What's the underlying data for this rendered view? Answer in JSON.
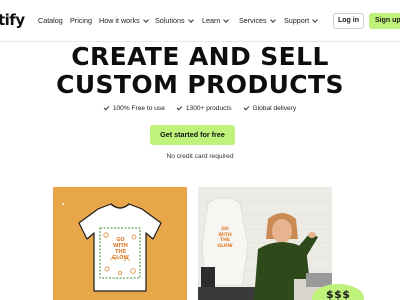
{
  "brand": {
    "logo_text": "tify"
  },
  "nav": {
    "items": [
      {
        "label": "Catalog",
        "dropdown": false
      },
      {
        "label": "Pricing",
        "dropdown": false
      },
      {
        "label": "How it works",
        "dropdown": true
      },
      {
        "label": "Solutions",
        "dropdown": true
      },
      {
        "label": "Learn",
        "dropdown": true
      },
      {
        "label": "Services",
        "dropdown": true
      },
      {
        "label": "Support",
        "dropdown": true
      }
    ],
    "login_label": "Log in",
    "signup_label": "Sign up"
  },
  "hero": {
    "headline_line1": "CREATE AND SELL",
    "headline_line2": "CUSTOM PRODUCTS",
    "features": [
      "100% Free to use",
      "1300+ products",
      "Global delivery"
    ],
    "cta_label": "Get started for free",
    "subnote": "No credit card required"
  },
  "media": {
    "shirt_print_text": "GO WITH THE GLOW",
    "sticker_text": "$$$"
  },
  "colors": {
    "accent": "#bff27a",
    "card_orange": "#e8a64a",
    "dark_green": "#2f4a1a"
  }
}
